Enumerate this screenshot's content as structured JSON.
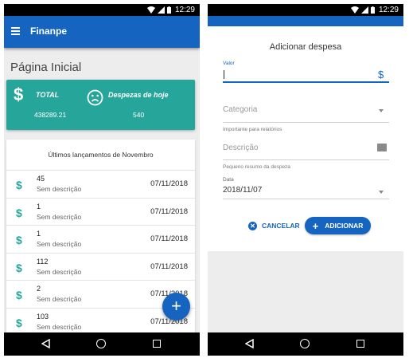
{
  "status": {
    "time": "12:29"
  },
  "app": {
    "title": "Finanpe"
  },
  "home": {
    "page_title": "Página Inicial",
    "summary": {
      "total_label": "TOTAL",
      "total_value": "438289.21",
      "today_label": "Despezas de hoje",
      "today_value": "540"
    },
    "list_header": "Últimos lançamentos de Novembro",
    "entries": [
      {
        "value": "45",
        "desc": "Sem descrição",
        "date": "07/11/2018"
      },
      {
        "value": "1",
        "desc": "Sem descrição",
        "date": "07/11/2018"
      },
      {
        "value": "1",
        "desc": "Sem descrição",
        "date": "07/11/2018"
      },
      {
        "value": "112",
        "desc": "Sem descrição",
        "date": "07/11/2018"
      },
      {
        "value": "2",
        "desc": "Sem descrição",
        "date": "07/11/2018"
      },
      {
        "value": "103",
        "desc": "Sem descrição",
        "date": "07/11/2018"
      }
    ],
    "fab_label": "+"
  },
  "dialog": {
    "title": "Adicionar despesa",
    "valor_label": "Valor",
    "valor_value": "",
    "category_placeholder": "Categoria",
    "category_hint": "Importante para relatórios",
    "description_placeholder": "Descrição",
    "description_hint": "Pequeno resumo da despeza",
    "date_label": "Data",
    "date_value": "2018/11/07",
    "cancel_label": "CANCELAR",
    "add_label": "ADICIONAR"
  },
  "icons": {
    "currency": "$",
    "accent": "#26a69a",
    "primary": "#1565c0"
  }
}
